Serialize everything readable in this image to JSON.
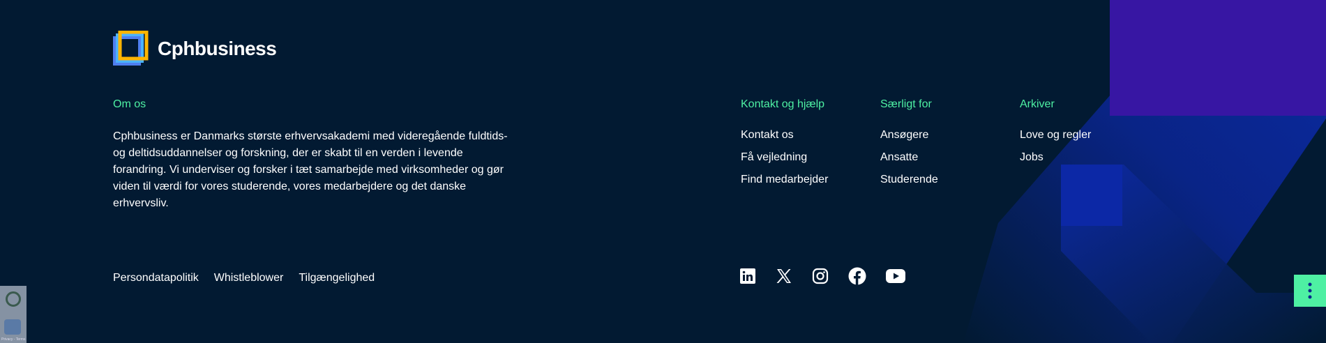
{
  "brand": {
    "name": "Cphbusiness"
  },
  "about": {
    "heading": "Om os",
    "text": "Cphbusiness er Danmarks største erhvervsakademi med videregående fuldtids- og deltidsuddannelser og forskning, der er skabt til en verden i levende forandring. Vi underviser og forsker i tæt samarbejde med virksomheder og gør viden til værdi for vores studerende, vores medarbejdere og det danske erhvervsliv."
  },
  "columns": [
    {
      "heading": "Kontakt og hjælp",
      "links": [
        "Kontakt os",
        "Få vejledning",
        "Find medarbejder"
      ]
    },
    {
      "heading": "Særligt for",
      "links": [
        "Ansøgere",
        "Ansatte",
        "Studerende"
      ]
    },
    {
      "heading": "Arkiver",
      "links": [
        "Love og regler",
        "Jobs"
      ]
    }
  ],
  "bottom_links": [
    "Persondatapolitik",
    "Whistleblower",
    "Tilgængelighed"
  ],
  "social": [
    "linkedin-icon",
    "x-twitter-icon",
    "instagram-icon",
    "facebook-icon",
    "youtube-icon"
  ],
  "recaptcha_label": "Privacy - Terms",
  "colors": {
    "background": "#021a32",
    "accent": "#4ef0a3",
    "deco_blue": "#0a2aa6",
    "deco_purple": "#3716a3"
  }
}
